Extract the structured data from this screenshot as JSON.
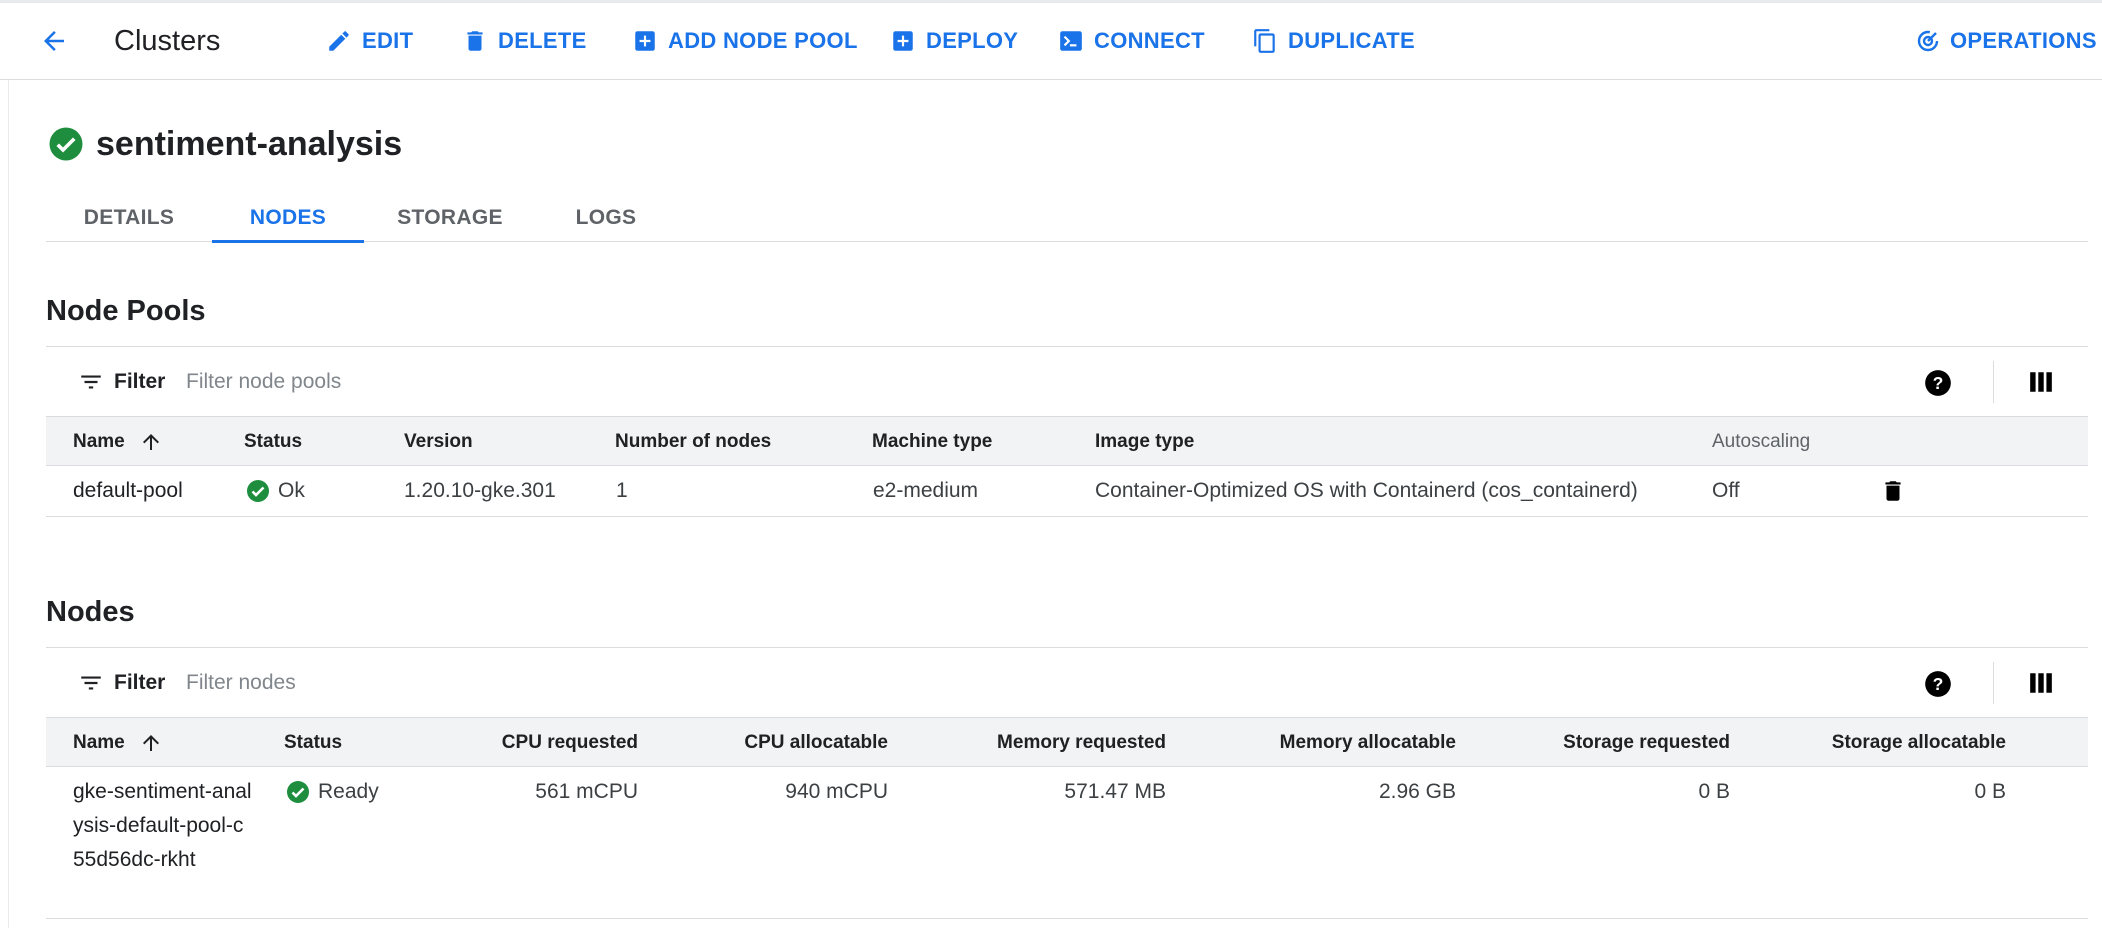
{
  "header": {
    "title": "Clusters",
    "actions": {
      "edit": "EDIT",
      "delete": "DELETE",
      "add_node_pool": "ADD NODE POOL",
      "deploy": "DEPLOY",
      "connect": "CONNECT",
      "duplicate": "DUPLICATE",
      "operations": "OPERATIONS"
    }
  },
  "cluster": {
    "name": "sentiment-analysis",
    "status_color": "#1e8e3e"
  },
  "tabs": [
    {
      "label": "DETAILS",
      "active": false
    },
    {
      "label": "NODES",
      "active": true
    },
    {
      "label": "STORAGE",
      "active": false
    },
    {
      "label": "LOGS",
      "active": false
    }
  ],
  "node_pools": {
    "title": "Node Pools",
    "filter_label": "Filter",
    "filter_placeholder": "Filter node pools",
    "columns": {
      "name": "Name",
      "status": "Status",
      "version": "Version",
      "number_of_nodes": "Number of nodes",
      "machine_type": "Machine type",
      "image_type": "Image type",
      "autoscaling": "Autoscaling"
    },
    "rows": [
      {
        "name": "default-pool",
        "status": "Ok",
        "version": "1.20.10-gke.301",
        "number_of_nodes": "1",
        "machine_type": "e2-medium",
        "image_type": "Container-Optimized OS with Containerd (cos_containerd)",
        "autoscaling": "Off"
      }
    ]
  },
  "nodes": {
    "title": "Nodes",
    "filter_label": "Filter",
    "filter_placeholder": "Filter nodes",
    "columns": {
      "name": "Name",
      "status": "Status",
      "cpu_requested": "CPU requested",
      "cpu_allocatable": "CPU allocatable",
      "memory_requested": "Memory requested",
      "memory_allocatable": "Memory allocatable",
      "storage_requested": "Storage requested",
      "storage_allocatable": "Storage allocatable"
    },
    "rows": [
      {
        "name": "gke-sentiment-analysis-default-pool-c55d56dc-rkht",
        "status": "Ready",
        "cpu_requested": "561 mCPU",
        "cpu_allocatable": "940 mCPU",
        "memory_requested": "571.47 MB",
        "memory_allocatable": "2.96 GB",
        "storage_requested": "0 B",
        "storage_allocatable": "0 B"
      }
    ]
  },
  "colors": {
    "accent": "#1a73e8",
    "ok": "#1e8e3e",
    "header_bg": "#f1f3f4",
    "border": "#dadce0"
  },
  "icons": {
    "back": "arrow-left-icon",
    "edit": "pencil-icon",
    "delete": "trash-icon",
    "add": "plus-box-icon",
    "connect": "terminal-icon",
    "duplicate": "copy-icon",
    "operations": "operations-icon",
    "filter": "filter-icon",
    "help": "help-icon",
    "columns": "columns-icon",
    "sort": "arrow-up-icon",
    "status": "check-circle-icon"
  }
}
